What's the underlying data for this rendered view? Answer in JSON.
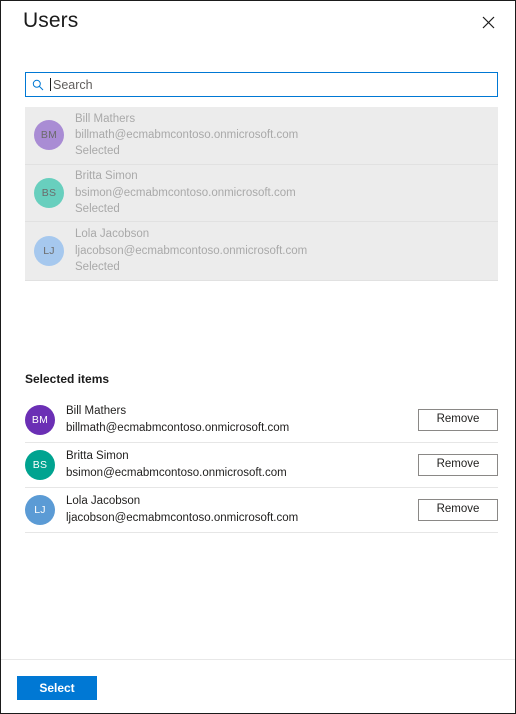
{
  "panel": {
    "title": "Users",
    "close_icon": "close-icon"
  },
  "search": {
    "icon": "search-icon",
    "value": "",
    "placeholder": "Search"
  },
  "results": {
    "status_label": "Selected",
    "rows": [
      {
        "initials": "BM",
        "name": "Bill Mathers",
        "email": "billmath@ecmabmcontoso.onmicrosoft.com",
        "status": "Selected",
        "avatar_color": "#a98cd4"
      },
      {
        "initials": "BS",
        "name": "Britta Simon",
        "email": "bsimon@ecmabmcontoso.onmicrosoft.com",
        "status": "Selected",
        "avatar_color": "#68cfbe"
      },
      {
        "initials": "LJ",
        "name": "Lola Jacobson",
        "email": "ljacobson@ecmabmcontoso.onmicrosoft.com",
        "status": "Selected",
        "avatar_color": "#a6c8ee"
      }
    ]
  },
  "selected_items": {
    "heading": "Selected items",
    "rows": [
      {
        "initials": "BM",
        "name": "Bill Mathers",
        "email": "billmath@ecmabmcontoso.onmicrosoft.com",
        "avatar_color": "#6b2fb5",
        "remove_label": "Remove"
      },
      {
        "initials": "BS",
        "name": "Britta Simon",
        "email": "bsimon@ecmabmcontoso.onmicrosoft.com",
        "avatar_color": "#00a390",
        "remove_label": "Remove"
      },
      {
        "initials": "LJ",
        "name": "Lola Jacobson",
        "email": "ljacobson@ecmabmcontoso.onmicrosoft.com",
        "avatar_color": "#5b9bd5",
        "remove_label": "Remove"
      }
    ]
  },
  "footer": {
    "select_label": "Select"
  },
  "colors": {
    "accent": "#0078d4",
    "search_border": "#0078d4",
    "list_background": "#ececec",
    "text_primary": "#201f1e",
    "text_disabled": "#a9a9a9"
  }
}
